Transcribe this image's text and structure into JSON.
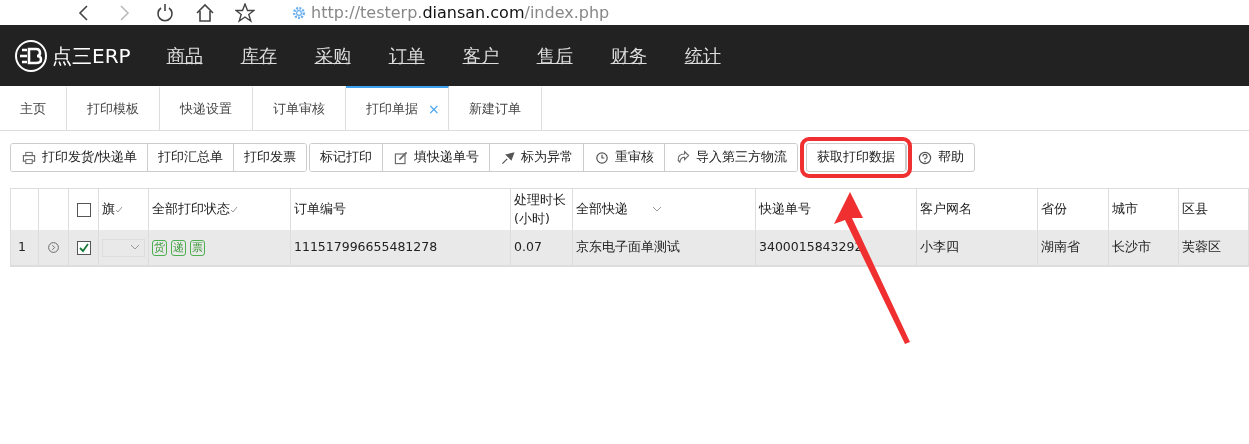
{
  "browser": {
    "url": "http://testerp.**diansan.com**/index.php"
  },
  "app": {
    "logo": "点三ERP",
    "menu": [
      "商品",
      "库存",
      "采购",
      "订单",
      "客户",
      "售后",
      "财务",
      "统计"
    ]
  },
  "tabs": [
    {
      "label": "主页",
      "selected": false,
      "closable": false
    },
    {
      "label": "打印模板",
      "selected": false,
      "closable": false
    },
    {
      "label": "快递设置",
      "selected": false,
      "closable": false
    },
    {
      "label": "订单审核",
      "selected": false,
      "closable": false
    },
    {
      "label": "打印单据",
      "selected": true,
      "closable": true,
      "close": "×"
    },
    {
      "label": "新建订单",
      "selected": false,
      "closable": false
    }
  ],
  "toolbar": [
    [
      {
        "label": "打印发货/快递单"
      },
      {
        "label": "打印汇总单"
      },
      {
        "label": "打印发票"
      }
    ],
    [
      {
        "label": "标记打印"
      },
      {
        "label": "填快递单号"
      },
      {
        "label": "标为异常"
      },
      {
        "label": "重审核"
      },
      {
        "label": "导入第三方物流"
      }
    ],
    [
      {
        "label": "获取打印数据",
        "highlighted": true
      },
      {
        "label": "帮助"
      }
    ]
  ],
  "table": {
    "columns": [
      {
        "kind": "blank"
      },
      {
        "kind": "blank"
      },
      {
        "kind": "check",
        "checked": false
      },
      {
        "label": "旗",
        "sort": true
      },
      {
        "label": "全部打印状态",
        "sort": true
      },
      {
        "label": "订单编号"
      },
      {
        "label": "处理时长(小时)"
      },
      {
        "label": "全部快递",
        "dropdown": true
      },
      {
        "label": "快递单号"
      },
      {
        "label": "客户网名"
      },
      {
        "label": "省份"
      },
      {
        "label": "城市"
      },
      {
        "label": "区县"
      }
    ],
    "rows": [
      {
        "cells": [
          {
            "kind": "text",
            "text": "1"
          },
          {
            "kind": "expand"
          },
          {
            "kind": "check",
            "checked": true
          },
          {
            "kind": "select"
          },
          {
            "kind": "tags",
            "tags": [
              "货",
              "递",
              "票"
            ]
          },
          {
            "kind": "text",
            "text": "111517996655481278"
          },
          {
            "kind": "text",
            "text": "0.07"
          },
          {
            "kind": "text",
            "text": "京东电子面单测试"
          },
          {
            "kind": "text",
            "text": "3400015843292"
          },
          {
            "kind": "text",
            "text": "小李四"
          },
          {
            "kind": "text",
            "text": "湖南省"
          },
          {
            "kind": "text",
            "text": "长沙市"
          },
          {
            "kind": "text",
            "text": "芙蓉区"
          }
        ]
      }
    ]
  }
}
